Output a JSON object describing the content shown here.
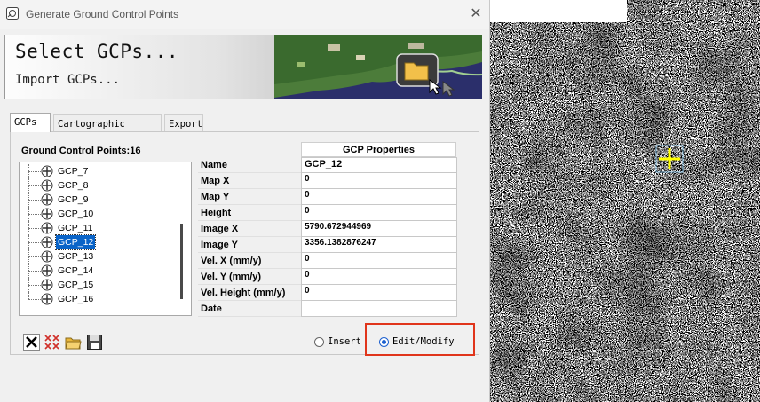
{
  "window": {
    "title": "Generate Ground Control Points"
  },
  "banner": {
    "title": "Select GCPs...",
    "subtitle": "Import GCPs..."
  },
  "tabs": [
    {
      "label": "GCPs",
      "active": true
    },
    {
      "label": "Cartographic System",
      "active": false
    },
    {
      "label": "Export",
      "active": false
    }
  ],
  "gcp_list": {
    "count_label": "Ground Control Points:16",
    "items": [
      "GCP_7",
      "GCP_8",
      "GCP_9",
      "GCP_10",
      "GCP_11",
      "GCP_12",
      "GCP_13",
      "GCP_14",
      "GCP_15",
      "GCP_16"
    ],
    "selected": "GCP_12"
  },
  "properties": {
    "header": "GCP Properties",
    "rows": [
      {
        "name": "Name",
        "value": "GCP_12"
      },
      {
        "name": "Map X",
        "value": "0"
      },
      {
        "name": "Map Y",
        "value": "0"
      },
      {
        "name": "Height",
        "value": "0"
      },
      {
        "name": "Image X",
        "value": "5790.672944969"
      },
      {
        "name": "Image Y",
        "value": "3356.1382876247"
      },
      {
        "name": "Vel. X (mm/y)",
        "value": "0"
      },
      {
        "name": "Vel. Y (mm/y)",
        "value": "0"
      },
      {
        "name": "Vel. Height (mm/y)",
        "value": "0"
      },
      {
        "name": "Date",
        "value": ""
      }
    ]
  },
  "mode": {
    "insert_label": "Insert",
    "edit_label": "Edit/Modify",
    "selected": "edit"
  },
  "colors": {
    "selection": "#0a64c8",
    "highlight_box": "#e0351b",
    "gcp_marker": "#ffff00"
  }
}
